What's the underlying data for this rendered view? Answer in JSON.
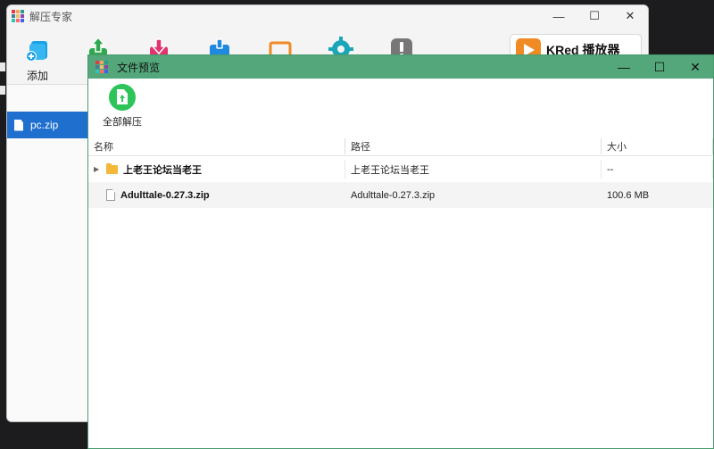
{
  "main_window": {
    "title": "解压专家",
    "controls": {
      "minimize": "—",
      "maximize": "☐",
      "close": "✕"
    },
    "toolbar": [
      {
        "name": "add",
        "label": "添加",
        "color": "#1aa1e8"
      },
      {
        "name": "extract",
        "label": "",
        "color": "#2fa84f"
      },
      {
        "name": "archive",
        "label": "",
        "color": "#e0336f"
      },
      {
        "name": "tool",
        "label": "",
        "color": "#1f88e0"
      },
      {
        "name": "device",
        "label": "",
        "color": "#f08a24"
      },
      {
        "name": "settings",
        "label": "",
        "color": "#1aa6b8"
      },
      {
        "name": "info",
        "label": "",
        "color": "#777777"
      }
    ],
    "ad": {
      "text": "KRed 播放器"
    },
    "sidebar": {
      "items": [
        {
          "label": "pc.zip",
          "selected": true
        }
      ]
    }
  },
  "preview_window": {
    "title": "文件预览",
    "controls": {
      "minimize": "—",
      "maximize": "☐",
      "close": "✕"
    },
    "toolbar": {
      "extract_all_label": "全部解压"
    },
    "columns": {
      "name": "名称",
      "path": "路径",
      "size": "大小"
    },
    "rows": [
      {
        "type": "folder",
        "name": "上老王论坛当老王",
        "path": "上老王论坛当老王",
        "size": "--",
        "expandable": true
      },
      {
        "type": "file",
        "name": "Adulttale-0.27.3.zip",
        "path": "Adulttale-0.27.3.zip",
        "size": "100.6 MB",
        "expandable": false
      }
    ]
  },
  "colors": {
    "accent_green": "#53a77a",
    "selection_blue": "#1f6fcf",
    "folder_yellow": "#f3b73a"
  }
}
